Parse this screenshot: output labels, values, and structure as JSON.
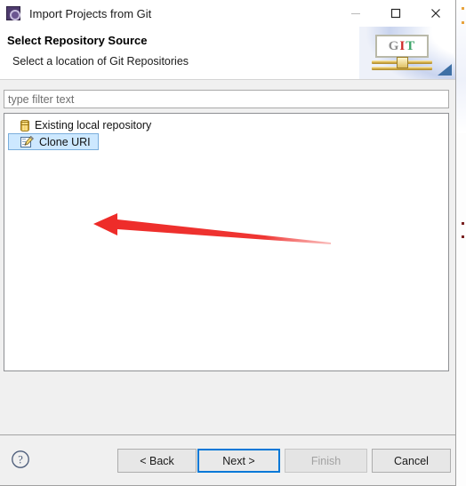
{
  "window": {
    "title": "Import Projects from Git",
    "icon": "eclipse-gear-icon",
    "controls": {
      "minimize": "minimize-icon",
      "maximize": "maximize-icon",
      "close": "close-icon"
    }
  },
  "header": {
    "title": "Select Repository Source",
    "subtitle": "Select a location of Git Repositories",
    "banner": {
      "letter_g": "G",
      "letter_i": "I",
      "letter_t": "T",
      "color_g": "#8f8f8f",
      "color_i": "#cf2a2a",
      "color_t": "#3fa46a"
    }
  },
  "filter": {
    "value": "",
    "placeholder": "type filter text"
  },
  "tree": {
    "items": [
      {
        "label": "Existing local repository",
        "icon": "repository-cylinder-icon",
        "selected": false
      },
      {
        "label": "Clone URI",
        "icon": "clone-uri-page-pencil-icon",
        "selected": true
      }
    ],
    "selection_color": "#cde8ff",
    "selection_border": "#7aaedc"
  },
  "annotation": {
    "type": "arrow",
    "direction": "left",
    "color": "#ee2b28",
    "target": "Clone URI"
  },
  "footer": {
    "help": "help-icon",
    "buttons": [
      {
        "id": "back",
        "label": "< Back",
        "enabled": true,
        "default": false
      },
      {
        "id": "next",
        "label": "Next >",
        "enabled": true,
        "default": true
      },
      {
        "id": "finish",
        "label": "Finish",
        "enabled": false,
        "default": false
      },
      {
        "id": "cancel",
        "label": "Cancel",
        "enabled": true,
        "default": false
      }
    ],
    "default_button_border": "#0078d7"
  }
}
